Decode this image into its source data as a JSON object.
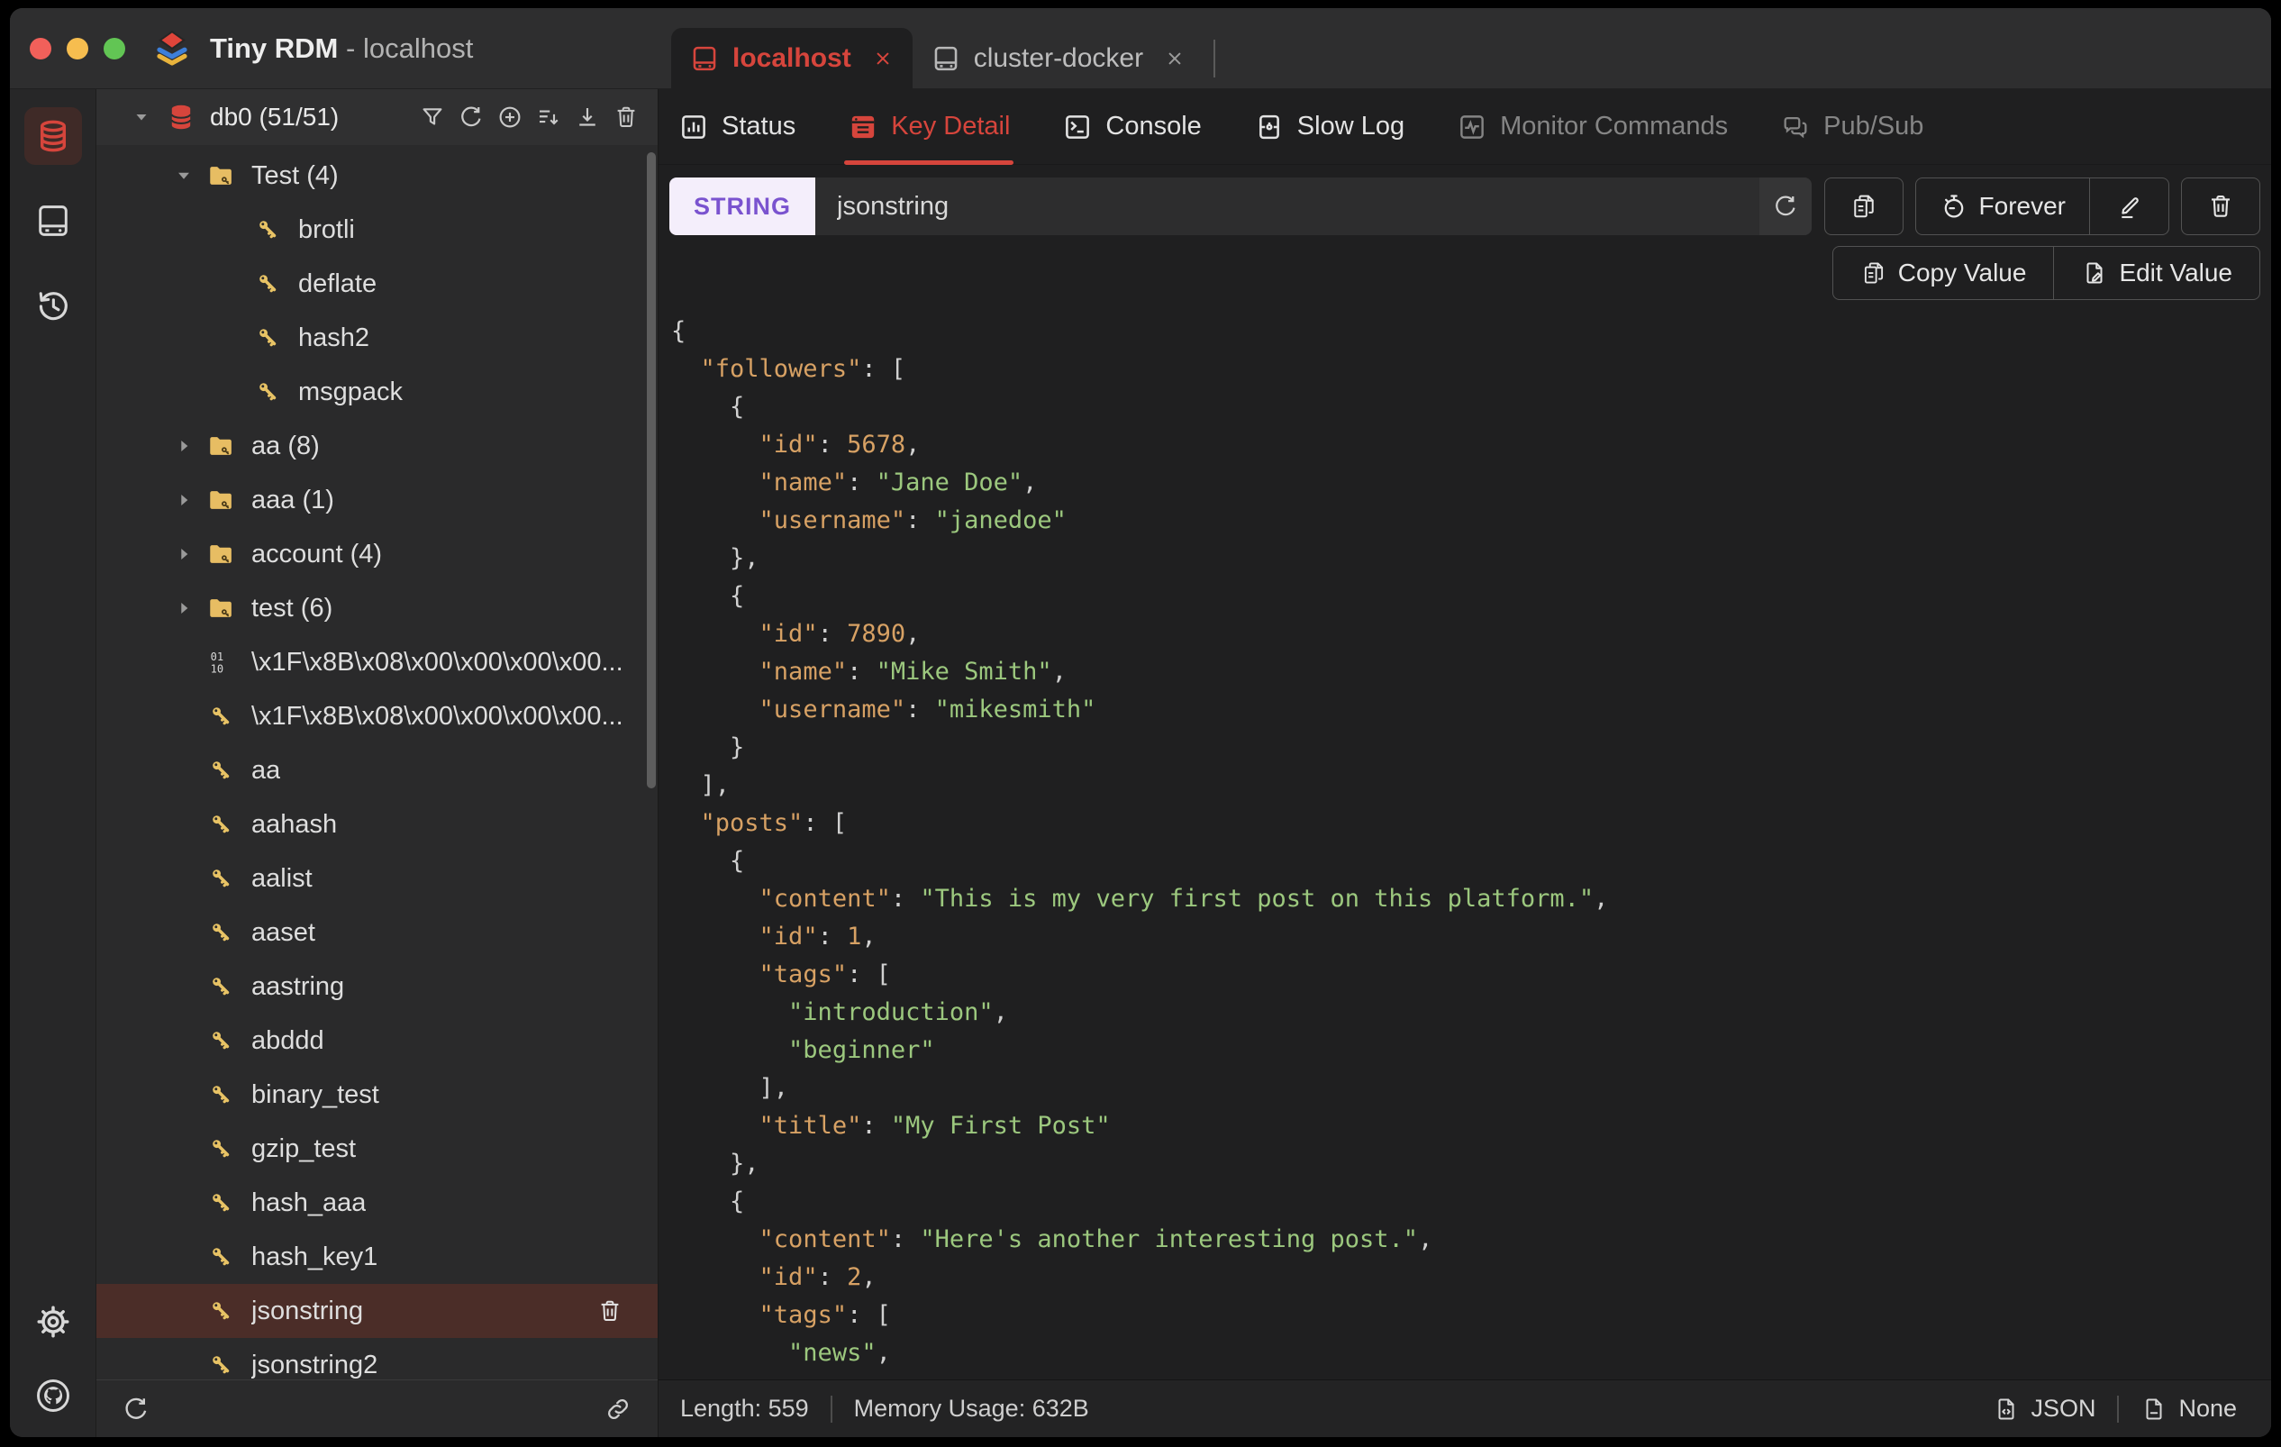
{
  "titlebar": {
    "app_name": "Tiny RDM",
    "host_suffix": "- localhost"
  },
  "connection_tabs": [
    {
      "id": "localhost",
      "label": "localhost",
      "active": true
    },
    {
      "id": "cluster-docker",
      "label": "cluster-docker",
      "active": false
    }
  ],
  "nav_tabs": [
    {
      "id": "status",
      "label": "Status",
      "state": "normal"
    },
    {
      "id": "key-detail",
      "label": "Key Detail",
      "state": "active"
    },
    {
      "id": "console",
      "label": "Console",
      "state": "normal"
    },
    {
      "id": "slow-log",
      "label": "Slow Log",
      "state": "normal"
    },
    {
      "id": "monitor-commands",
      "label": "Monitor Commands",
      "state": "disabled"
    },
    {
      "id": "pub-sub",
      "label": "Pub/Sub",
      "state": "disabled"
    }
  ],
  "tree": {
    "database_label": "db0 (51/51)",
    "items": [
      {
        "type": "folder",
        "label": "Test (4)",
        "expanded": true
      },
      {
        "type": "key",
        "label": "brotli",
        "level": 1
      },
      {
        "type": "key",
        "label": "deflate",
        "level": 1
      },
      {
        "type": "key",
        "label": "hash2",
        "level": 1
      },
      {
        "type": "key",
        "label": "msgpack",
        "level": 1
      },
      {
        "type": "folder",
        "label": "aa (8)",
        "expanded": false
      },
      {
        "type": "folder",
        "label": "aaa (1)",
        "expanded": false
      },
      {
        "type": "folder",
        "label": "account (4)",
        "expanded": false
      },
      {
        "type": "folder",
        "label": "test (6)",
        "expanded": false
      },
      {
        "type": "binary",
        "label": "\\x1F\\x8B\\x08\\x00\\x00\\x00\\x00..."
      },
      {
        "type": "key",
        "label": "\\x1F\\x8B\\x08\\x00\\x00\\x00\\x00..."
      },
      {
        "type": "key",
        "label": "aa"
      },
      {
        "type": "key",
        "label": "aahash"
      },
      {
        "type": "key",
        "label": "aalist"
      },
      {
        "type": "key",
        "label": "aaset"
      },
      {
        "type": "key",
        "label": "aastring"
      },
      {
        "type": "key",
        "label": "abddd"
      },
      {
        "type": "key",
        "label": "binary_test"
      },
      {
        "type": "key",
        "label": "gzip_test"
      },
      {
        "type": "key",
        "label": "hash_aaa"
      },
      {
        "type": "key",
        "label": "hash_key1"
      },
      {
        "type": "key",
        "label": "jsonstring",
        "selected": true
      },
      {
        "type": "key",
        "label": "jsonstring2"
      }
    ]
  },
  "key_detail": {
    "type_badge": "STRING",
    "key_name": "jsonstring",
    "ttl_button": "Forever",
    "copy_value_button": "Copy Value",
    "edit_value_button": "Edit Value",
    "value_lines": [
      "{",
      "  \"followers\": [",
      "    {",
      "      \"id\": 5678,",
      "      \"name\": \"Jane Doe\",",
      "      \"username\": \"janedoe\"",
      "    },",
      "    {",
      "      \"id\": 7890,",
      "      \"name\": \"Mike Smith\",",
      "      \"username\": \"mikesmith\"",
      "    }",
      "  ],",
      "  \"posts\": [",
      "    {",
      "      \"content\": \"This is my very first post on this platform.\",",
      "      \"id\": 1,",
      "      \"tags\": [",
      "        \"introduction\",",
      "        \"beginner\"",
      "      ],",
      "      \"title\": \"My First Post\"",
      "    },",
      "    {",
      "      \"content\": \"Here's another interesting post.\",",
      "      \"id\": 2,",
      "      \"tags\": [",
      "        \"news\","
    ]
  },
  "status_bar": {
    "length": "Length: 559",
    "memory": "Memory Usage: 632B",
    "format": "JSON",
    "decode": "None"
  },
  "colors": {
    "accent_red": "#d6453c",
    "badge_purple": "#7a53cf",
    "key_gold": "#e8c365",
    "json_key_color": "#d7a164",
    "json_string_color": "#9cc87e",
    "selected_row": "#4b2d28"
  }
}
